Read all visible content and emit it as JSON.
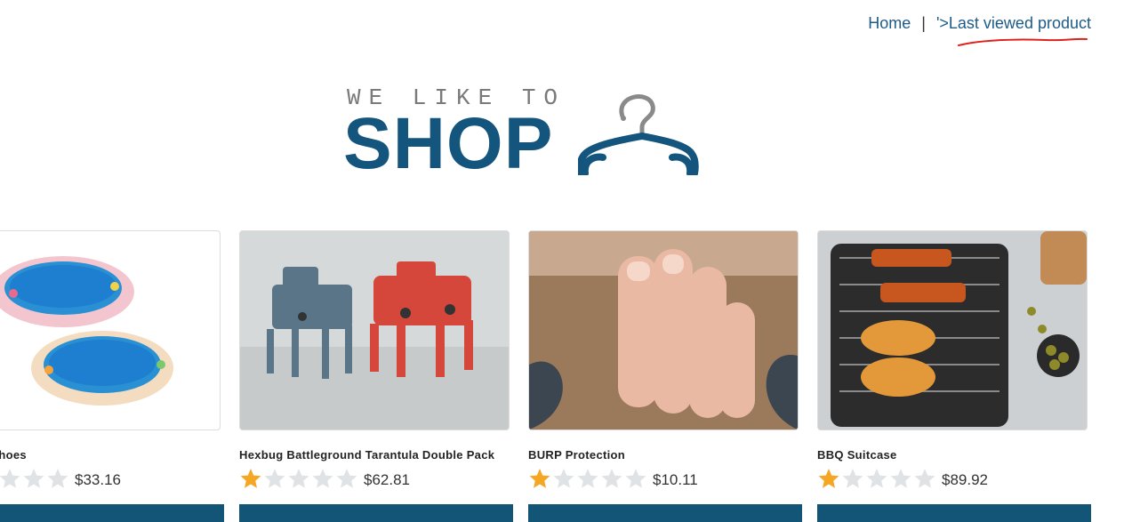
{
  "nav": {
    "home_label": "Home",
    "separator": "|",
    "last_viewed_label": "'>Last viewed product"
  },
  "logo": {
    "tagline": "WE LIKE TO",
    "word": "SHOP",
    "icon": "hanger-icon"
  },
  "colors": {
    "link": "#1d5b86",
    "brand": "#14557e",
    "button": "#135577",
    "star_filled": "#f5a623",
    "star_empty": "#dfe3e6",
    "annotation": "#e0201b"
  },
  "products": [
    {
      "name": "g Pool Shoes",
      "rating": 0,
      "price": "$33.16",
      "image": "inflatable-pools"
    },
    {
      "name": "Hexbug Battleground Tarantula Double Pack",
      "rating": 1,
      "price": "$62.81",
      "image": "robot-spiders"
    },
    {
      "name": "BURP Protection",
      "rating": 1,
      "price": "$10.11",
      "image": "hand-over-beard"
    },
    {
      "name": "BBQ Suitcase",
      "rating": 1,
      "price": "$89.92",
      "image": "grill-with-skewers"
    }
  ]
}
